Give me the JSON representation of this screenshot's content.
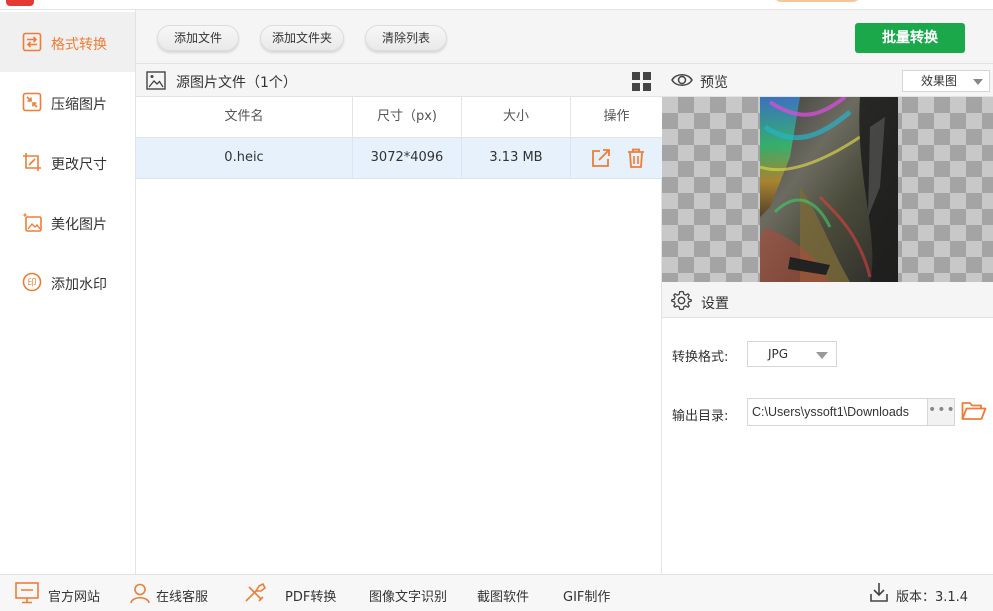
{
  "colors": {
    "accent": "#ef7d37",
    "primary_green": "#1aa84a",
    "active_bg": "#f0f0f0",
    "selected_row": "#e6f1fb"
  },
  "sidebar": {
    "items": [
      {
        "label": "格式转换",
        "icon": "format-convert-icon",
        "active": true
      },
      {
        "label": "压缩图片",
        "icon": "compress-image-icon",
        "active": false
      },
      {
        "label": "更改尺寸",
        "icon": "resize-icon",
        "active": false
      },
      {
        "label": "美化图片",
        "icon": "beautify-icon",
        "active": false
      },
      {
        "label": "添加水印",
        "icon": "watermark-icon",
        "active": false
      }
    ]
  },
  "toolbar": {
    "add_file": "添加文件",
    "add_folder": "添加文件夹",
    "clear_list": "清除列表",
    "batch_convert": "批量转换"
  },
  "file_panel": {
    "title": "源图片文件（1个）",
    "columns": [
      "文件名",
      "尺寸（px)",
      "大小",
      "操作"
    ],
    "rows": [
      {
        "name": "0.heic",
        "dimensions": "3072*4096",
        "size": "3.13 MB"
      }
    ]
  },
  "preview": {
    "title": "预览",
    "mode": "效果图"
  },
  "settings": {
    "title": "设置",
    "format_label": "转换格式:",
    "format_value": "JPG",
    "output_label": "输出目录:",
    "output_path": "C:\\Users\\yssoft1\\Downloads",
    "browse_dots": "•••"
  },
  "bottom": {
    "website": "官方网站",
    "support": "在线客服",
    "pdf": "PDF转换",
    "ocr": "图像文字识别",
    "screenshot": "截图软件",
    "gif": "GIF制作",
    "version_label": "版本：3.1.4"
  }
}
